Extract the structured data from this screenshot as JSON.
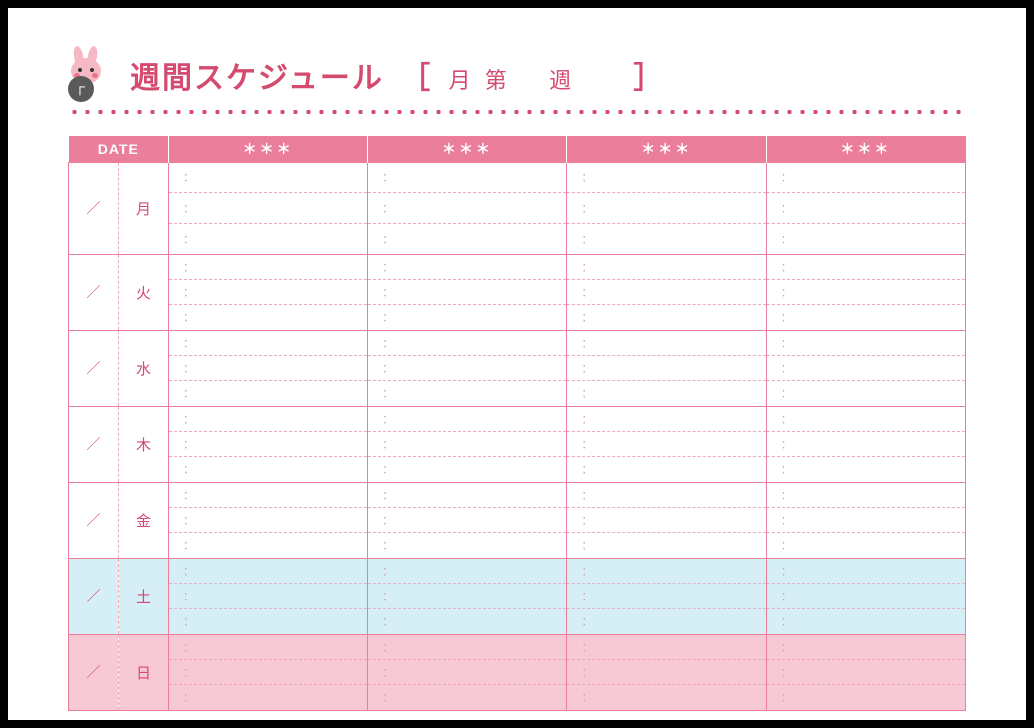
{
  "header": {
    "title_main": "週間スケジュール",
    "bracket_open": "［",
    "fill_month_label": "月 第",
    "fill_week_label": "週",
    "bracket_close": "］"
  },
  "table": {
    "date_header": "DATE",
    "column_placeholder": "＊＊＊",
    "columns": [
      "＊＊＊",
      "＊＊＊",
      "＊＊＊",
      "＊＊＊"
    ],
    "slash": "／",
    "slot_placeholder": "：",
    "days": [
      {
        "label": "月",
        "slots": 3,
        "kind": "first"
      },
      {
        "label": "火",
        "slots": 3,
        "kind": "weekday"
      },
      {
        "label": "水",
        "slots": 3,
        "kind": "weekday"
      },
      {
        "label": "木",
        "slots": 3,
        "kind": "weekday"
      },
      {
        "label": "金",
        "slots": 3,
        "kind": "weekday"
      },
      {
        "label": "土",
        "slots": 3,
        "kind": "sat"
      },
      {
        "label": "日",
        "slots": 3,
        "kind": "sun"
      }
    ]
  }
}
